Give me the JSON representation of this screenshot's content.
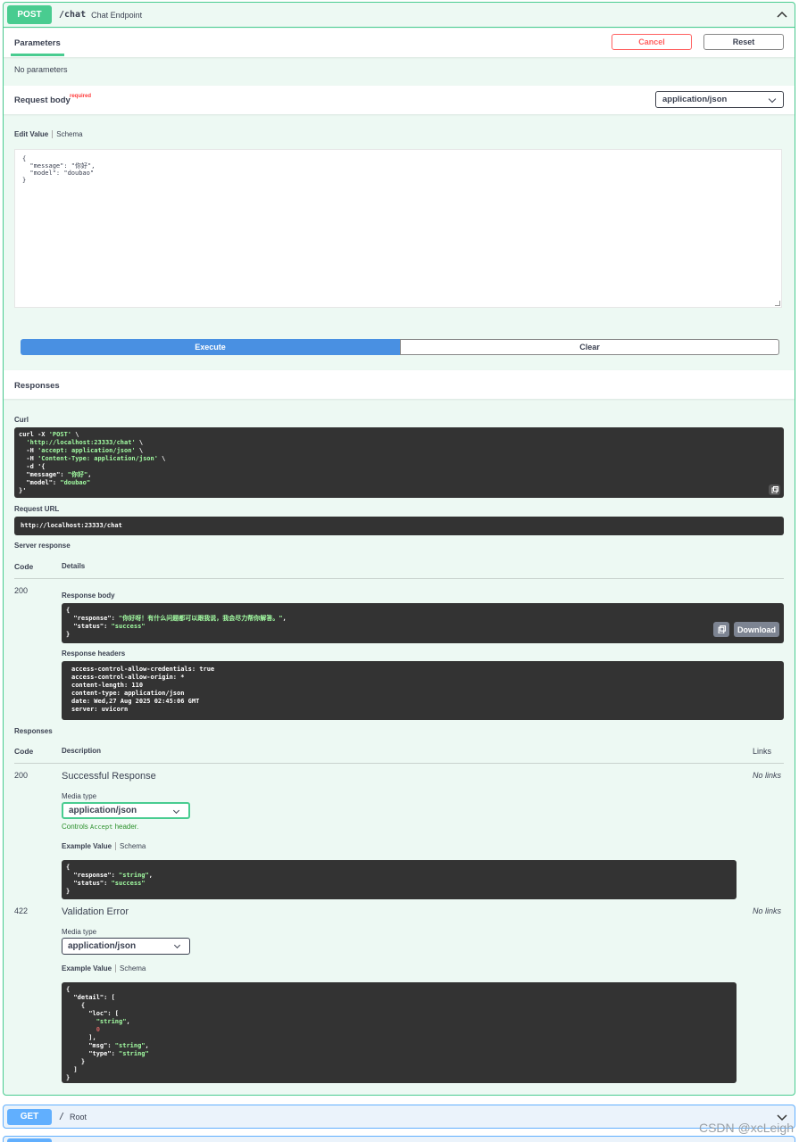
{
  "post_op": {
    "method": "POST",
    "path": "/chat",
    "summary": "Chat Endpoint"
  },
  "parameters": {
    "tab_label": "Parameters",
    "cancel_label": "Cancel",
    "reset_label": "Reset",
    "empty_text": "No parameters"
  },
  "request_body": {
    "title": "Request body",
    "required_label": "required",
    "content_type": "application/json",
    "edit_value_tab": "Edit Value",
    "schema_tab": "Schema",
    "value_lines": [
      "{",
      "  \"message\": \"你好\",",
      "  \"model\": \"doubao\"",
      "}"
    ]
  },
  "actions": {
    "execute_label": "Execute",
    "clear_label": "Clear"
  },
  "responses_header": "Responses",
  "curl": {
    "label": "Curl",
    "lines": [
      "curl -X 'POST' \\",
      "  'http://localhost:23333/chat' \\",
      "  -H 'accept: application/json' \\",
      "  -H 'Content-Type: application/json' \\",
      "  -d '{",
      "  \"message\": \"你好\",",
      "  \"model\": \"doubao\"",
      "}'"
    ]
  },
  "request_url": {
    "label": "Request URL",
    "value": "http://localhost:23333/chat"
  },
  "server_response": {
    "label": "Server response",
    "code_header": "Code",
    "details_header": "Details",
    "code": "200",
    "body_label": "Response body",
    "body_lines": [
      "{",
      "  \"response\": \"你好呀！有什么问题都可以跟我说，我会尽力帮你解答。\",",
      "  \"status\": \"success\"",
      "}"
    ],
    "download_label": "Download",
    "headers_label": "Response headers",
    "headers_lines": [
      "access-control-allow-credentials: true",
      "access-control-allow-origin: *",
      "content-length: 110",
      "content-type: application/json",
      "date: Wed,27 Aug 2025 02:45:06 GMT",
      "server: uvicorn"
    ]
  },
  "responses": {
    "label": "Responses",
    "code_header": "Code",
    "description_header": "Description",
    "links_header": "Links",
    "media_type_label": "Media type",
    "controls_text_prefix": "Controls",
    "controls_code": "Accept",
    "controls_text_suffix": "header.",
    "example_value_tab": "Example Value",
    "schema_tab": "Schema",
    "items": [
      {
        "code": "200",
        "description": "Successful Response",
        "links": "No links",
        "media_type": "application/json",
        "example_lines": [
          "{",
          "  \"response\": \"string\",",
          "  \"status\": \"success\"",
          "}"
        ]
      },
      {
        "code": "422",
        "description": "Validation Error",
        "links": "No links",
        "media_type": "application/json",
        "example_lines": [
          "{",
          "  \"detail\": [",
          "    {",
          "      \"loc\": [",
          "        \"string\",",
          "        0",
          "      ],",
          "      \"msg\": \"string\",",
          "      \"type\": \"string\"",
          "    }",
          "  ]",
          "}"
        ]
      }
    ]
  },
  "get_op": {
    "method": "GET",
    "path": "/",
    "summary": "Root"
  },
  "watermark": "CSDN @xcLeigh",
  "colors": {
    "post": "#49cc90",
    "get": "#61affe",
    "execute": "#4990e2",
    "cancel": "#ff6060",
    "code_bg": "#333333",
    "string": "#a2fca2"
  }
}
